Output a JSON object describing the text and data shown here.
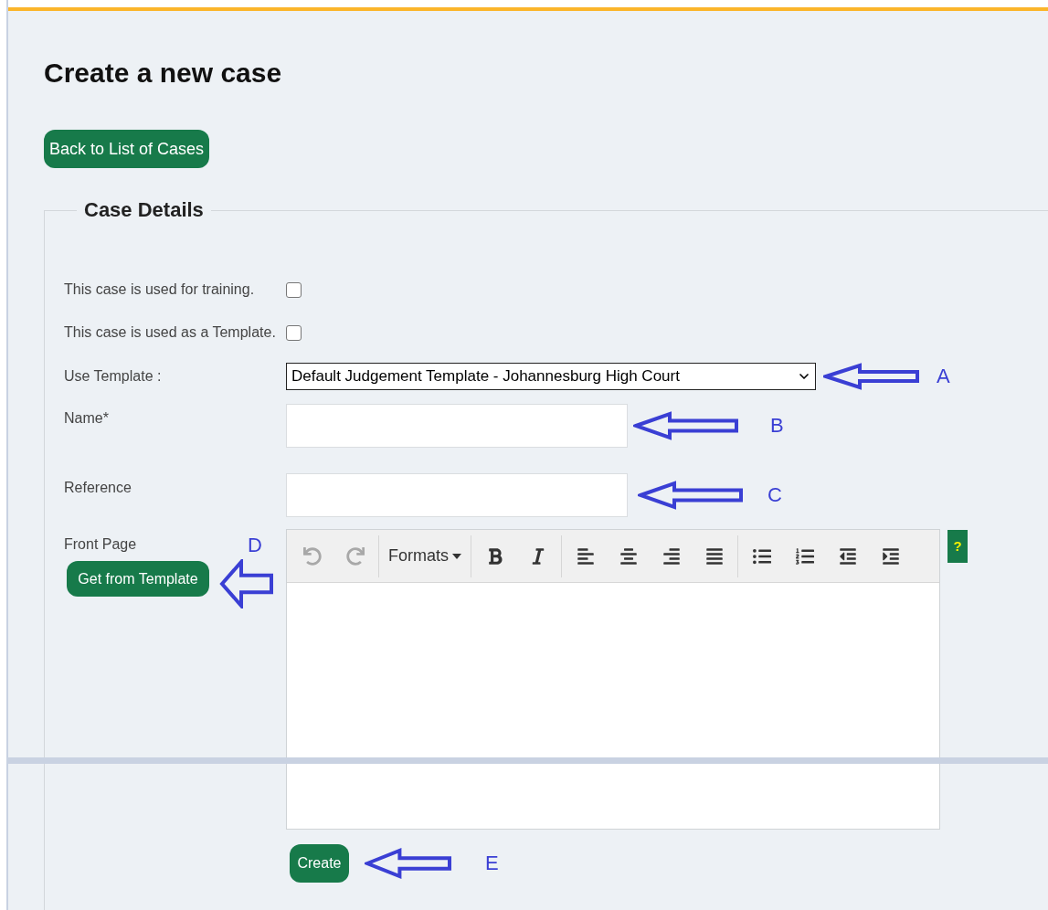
{
  "page": {
    "title": "Create a new case",
    "back_button": "Back to List of Cases"
  },
  "case_details": {
    "legend": "Case Details",
    "checkboxes": [
      {
        "label": "This case is used for training.",
        "checked": false
      },
      {
        "label": "This case is used as a Template.",
        "checked": false
      }
    ],
    "use_template": {
      "label": "Use Template :",
      "value": "Default Judgement Template - Johannesburg High Court",
      "annotation": "A"
    },
    "name": {
      "label": "Name*",
      "annotation": "B"
    },
    "reference": {
      "label": "Reference",
      "annotation": "C"
    },
    "front_page": {
      "label": "Front Page",
      "annotation": "D",
      "template_button": "Get from Template",
      "help": "?",
      "toolbar": [
        {
          "items": [
            {
              "kind": "undo",
              "disabled": true
            },
            {
              "kind": "redo",
              "disabled": true
            }
          ]
        },
        {
          "items": [
            {
              "kind": "formats",
              "label": "Formats",
              "disabled": false
            }
          ]
        },
        {
          "items": [
            {
              "kind": "bold",
              "disabled": false
            },
            {
              "kind": "italic",
              "disabled": false
            }
          ]
        },
        {
          "items": [
            {
              "kind": "align-left",
              "disabled": false
            },
            {
              "kind": "align-center",
              "disabled": false
            },
            {
              "kind": "align-right",
              "disabled": false
            },
            {
              "kind": "align-justify",
              "disabled": false
            }
          ]
        },
        {
          "items": [
            {
              "kind": "bullet-list",
              "disabled": false
            },
            {
              "kind": "numbered-list",
              "disabled": false
            },
            {
              "kind": "outdent",
              "disabled": false
            },
            {
              "kind": "indent",
              "disabled": false
            }
          ]
        }
      ]
    },
    "create_button": "Create",
    "create_annotation": "E"
  }
}
